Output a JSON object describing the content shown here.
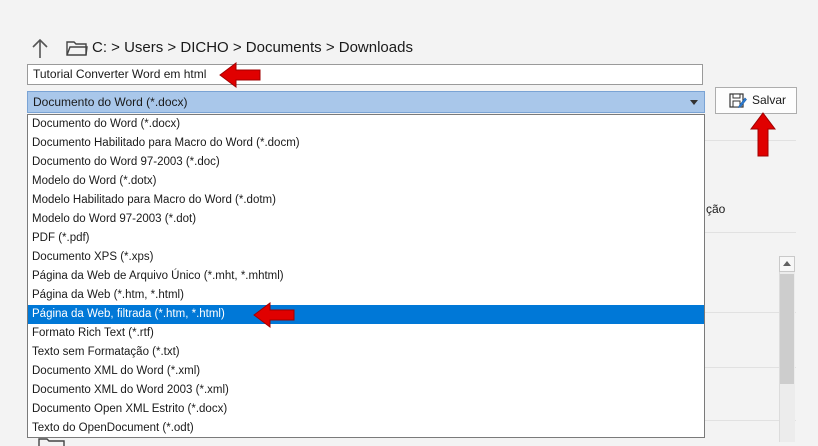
{
  "nav": {
    "path": "C:  >  Users  >  DICHO  >  Documents  >  Downloads"
  },
  "filename_field": {
    "value": "Tutorial Converter Word em html"
  },
  "filetype": {
    "selected": "Documento do Word (*.docx)",
    "options": [
      "Documento do Word (*.docx)",
      "Documento Habilitado para Macro do Word (*.docm)",
      "Documento do Word 97-2003 (*.doc)",
      "Modelo do Word (*.dotx)",
      "Modelo Habilitado para Macro do Word (*.dotm)",
      "Modelo do Word 97-2003 (*.dot)",
      "PDF (*.pdf)",
      "Documento XPS (*.xps)",
      "Página da Web de Arquivo Único (*.mht, *.mhtml)",
      "Página da Web (*.htm, *.html)",
      "Página da Web, filtrada (*.htm, *.html)",
      "Formato Rich Text (*.rtf)",
      "Texto sem Formatação (*.txt)",
      "Documento XML do Word (*.xml)",
      "Documento XML do Word 2003 (*.xml)",
      "Documento Open XML Estrito (*.docx)",
      "Texto do OpenDocument (*.odt)"
    ],
    "highlighted_index": 10
  },
  "save_button": {
    "label": "Salvar"
  },
  "background": {
    "partial_text": "ção"
  },
  "colors": {
    "selection": "#0078d7",
    "combo_bg": "#a9c7ea",
    "annotation_arrow": "#e00000"
  },
  "icons": [
    "up-arrow-icon",
    "folder-icon",
    "chevron-down-icon",
    "save-icon",
    "scroll-up-icon"
  ]
}
